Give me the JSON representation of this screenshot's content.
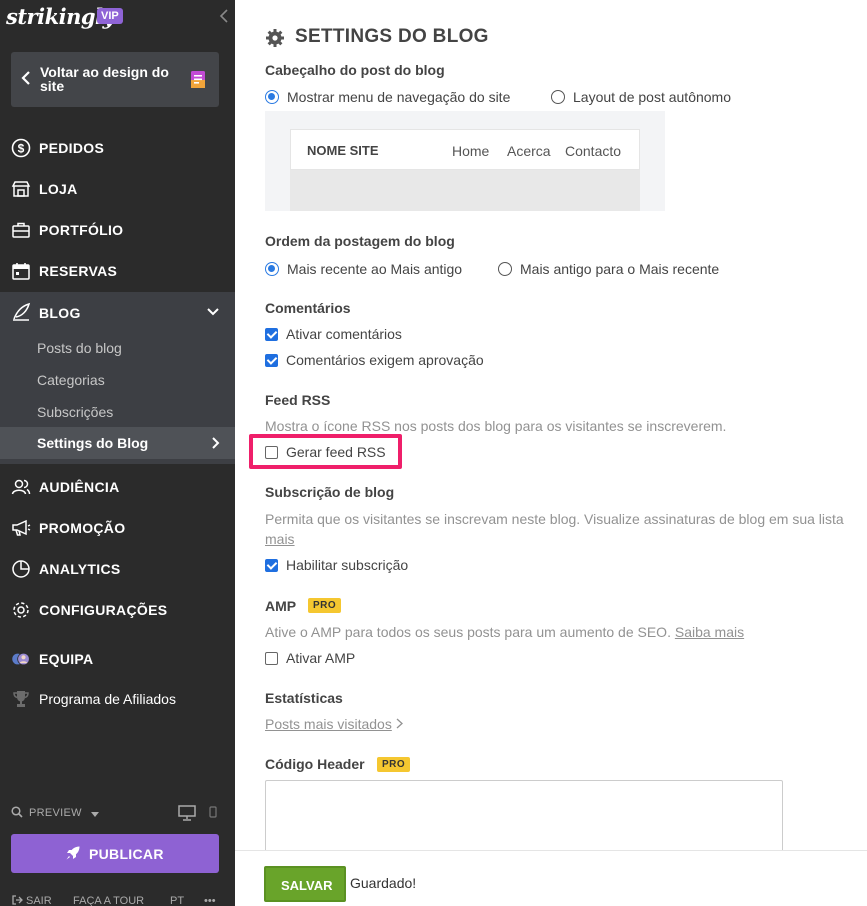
{
  "sidebar": {
    "brand": "strikingly",
    "vip_badge": "VIP",
    "back_label": "Voltar ao design do site",
    "nav": {
      "orders": "PEDIDOS",
      "store": "LOJA",
      "portfolio": "PORTFÓLIO",
      "bookings": "RESERVAS",
      "blog": "BLOG",
      "audience": "AUDIÊNCIA",
      "promotion": "PROMOÇÃO",
      "analytics": "ANALYTICS",
      "settings": "CONFIGURAÇÕES",
      "team": "EQUIPA",
      "affiliates": "Programa de Afiliados"
    },
    "blog_sub": {
      "posts": "Posts do blog",
      "categories": "Categorias",
      "subscriptions": "Subscrições",
      "settings": "Settings do Blog"
    },
    "preview_label": "PREVIEW",
    "publish_label": "PUBLICAR",
    "bottom": {
      "exit": "SAIR",
      "tour": "FAÇA A TOUR",
      "lang": "PT",
      "more": "•••"
    }
  },
  "main": {
    "title": "SETTINGS DO BLOG",
    "header_section": {
      "title": "Cabeçalho do post do blog",
      "option_nav": "Mostrar menu de navegação do site",
      "option_standalone": "Layout de post autônomo",
      "selected": "option_nav",
      "preview": {
        "site_name": "NOME SITE",
        "links": [
          "Home",
          "Acerca",
          "Contacto"
        ]
      }
    },
    "order_section": {
      "title": "Ordem da postagem do blog",
      "option_new": "Mais recente ao Mais antigo",
      "option_old": "Mais antigo para o Mais recente",
      "selected": "option_new"
    },
    "comments_section": {
      "title": "Comentários",
      "enable": "Ativar comentários",
      "require_approval": "Comentários exigem aprovação",
      "enable_checked": true,
      "approval_checked": true
    },
    "rss_section": {
      "title": "Feed RSS",
      "desc": "Mostra o ícone RSS nos posts dos blog para os visitantes se inscreverem.",
      "generate": "Gerar feed RSS",
      "generate_checked": false
    },
    "subscription_section": {
      "title": "Subscrição de blog",
      "desc": "Permita que os visitantes se inscrevam neste blog. Visualize assinaturas de blog em sua lista",
      "more_link": "mais",
      "enable": "Habilitar subscrição",
      "enable_checked": true
    },
    "amp_section": {
      "title": "AMP",
      "badge": "PRO",
      "desc": "Ative o AMP para todos os seus posts para um aumento de SEO.",
      "learn_more": "Saiba mais",
      "enable": "Ativar AMP",
      "enable_checked": false
    },
    "stats_section": {
      "title": "Estatísticas",
      "link": "Posts mais visitados"
    },
    "header_code_section": {
      "title": "Código Header",
      "badge": "PRO",
      "value": ""
    }
  },
  "footer": {
    "save_label": "SALVAR",
    "status": "Guardado!"
  },
  "colors": {
    "sidebar_bg": "#2b2b2b",
    "accent_purple": "#8e62d3",
    "save_green": "#69a42a",
    "highlight_pink": "#ef1f6a",
    "pro_yellow": "#f5c730"
  }
}
